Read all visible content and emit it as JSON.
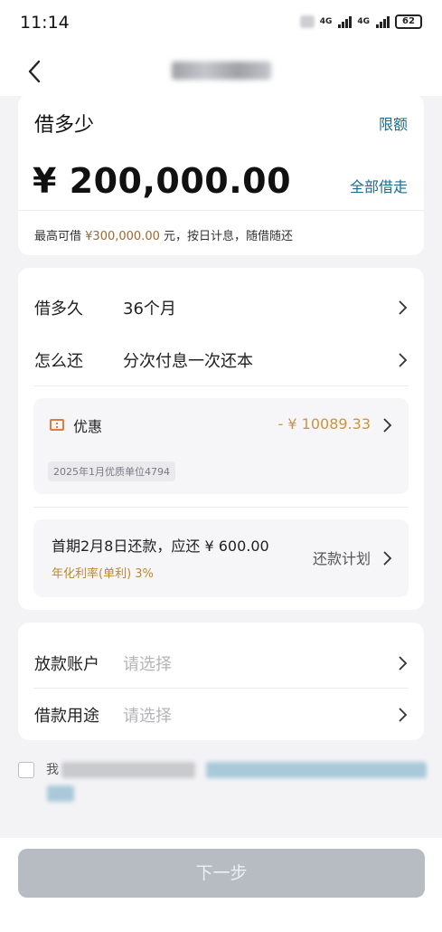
{
  "status_bar": {
    "time": "11:14",
    "net_1": "4G",
    "net_2": "4G",
    "battery": "62"
  },
  "amount_card": {
    "title": "借多少",
    "limit_link": "限额",
    "amount": "¥ 200,000.00",
    "borrow_all": "全部借走",
    "note_prefix": "最高可借",
    "note_max": "¥300,000.00",
    "note_suffix": "元，按日计息，随借随还"
  },
  "terms_card": {
    "term_label": "借多久",
    "term_value": "36个月",
    "repay_label": "怎么还",
    "repay_value": "分次付息一次还本",
    "discount": {
      "title": "优惠",
      "value": "- ¥ 10089.33",
      "tag": "2025年1月优质单位4794"
    },
    "first_payment": {
      "text": "首期2月8日还款，应还 ¥ 600.00",
      "rate": "年化利率(单利) 3%",
      "plan_link": "还款计划"
    }
  },
  "account_card": {
    "account_label": "放款账户",
    "account_placeholder": "请选择",
    "purpose_label": "借款用途",
    "purpose_placeholder": "请选择"
  },
  "agreement": {
    "prefix": "我"
  },
  "footer": {
    "next_button": "下一步"
  },
  "colors": {
    "link": "#1c6c8e",
    "max_amount": "#a3652d",
    "discount": "#c9953c",
    "button_disabled": "#b7bbc2"
  },
  "icons": [
    "back-arrow-icon",
    "chevron-right-icon",
    "coupon-icon",
    "signal-icon",
    "battery-icon"
  ]
}
